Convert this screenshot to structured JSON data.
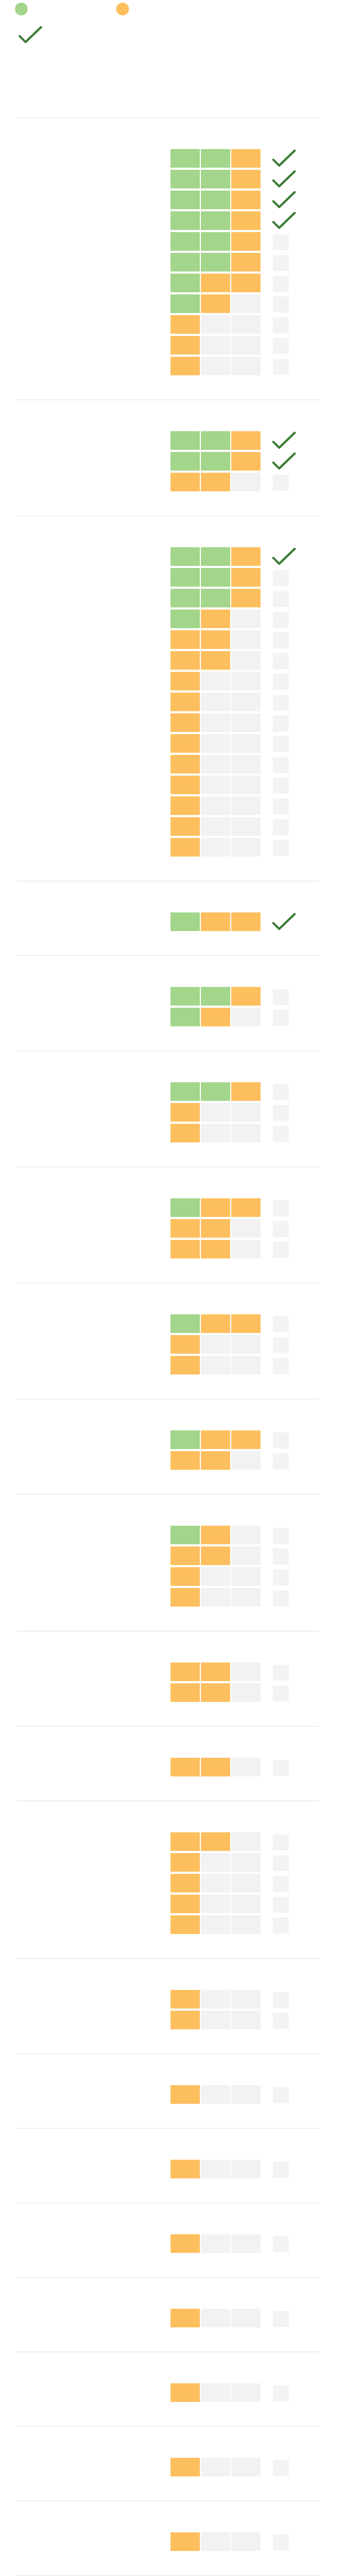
{
  "colors": {
    "green": "#a3d58a",
    "orange": "#fdbf5e",
    "empty": "#f2f2f2",
    "check": "#3a7a33",
    "divider": "#efefef"
  },
  "legend": [
    {
      "color": "green"
    },
    {
      "color": "orange"
    }
  ],
  "header": {
    "icon": "check-icon"
  },
  "groups": [
    {
      "rows": [
        {
          "cells": [
            "g",
            "g",
            "o"
          ],
          "checked": true
        },
        {
          "cells": [
            "g",
            "g",
            "o"
          ],
          "checked": true
        },
        {
          "cells": [
            "g",
            "g",
            "o"
          ],
          "checked": true
        },
        {
          "cells": [
            "g",
            "g",
            "o"
          ],
          "checked": true
        },
        {
          "cells": [
            "g",
            "g",
            "o"
          ],
          "checked": false
        },
        {
          "cells": [
            "g",
            "g",
            "o"
          ],
          "checked": false
        },
        {
          "cells": [
            "g",
            "o",
            "o"
          ],
          "checked": false
        },
        {
          "cells": [
            "g",
            "o",
            "e"
          ],
          "checked": false
        },
        {
          "cells": [
            "o",
            "e",
            "e"
          ],
          "checked": false
        },
        {
          "cells": [
            "o",
            "e",
            "e"
          ],
          "checked": false
        },
        {
          "cells": [
            "o",
            "e",
            "e"
          ],
          "checked": false
        }
      ]
    },
    {
      "rows": [
        {
          "cells": [
            "g",
            "g",
            "o"
          ],
          "checked": true
        },
        {
          "cells": [
            "g",
            "g",
            "o"
          ],
          "checked": true
        },
        {
          "cells": [
            "o",
            "o",
            "e"
          ],
          "checked": false
        }
      ]
    },
    {
      "rows": [
        {
          "cells": [
            "g",
            "g",
            "o"
          ],
          "checked": true
        },
        {
          "cells": [
            "g",
            "g",
            "o"
          ],
          "checked": false
        },
        {
          "cells": [
            "g",
            "g",
            "o"
          ],
          "checked": false
        },
        {
          "cells": [
            "g",
            "o",
            "e"
          ],
          "checked": false
        },
        {
          "cells": [
            "o",
            "o",
            "e"
          ],
          "checked": false
        },
        {
          "cells": [
            "o",
            "o",
            "e"
          ],
          "checked": false
        },
        {
          "cells": [
            "o",
            "e",
            "e"
          ],
          "checked": false
        },
        {
          "cells": [
            "o",
            "e",
            "e"
          ],
          "checked": false
        },
        {
          "cells": [
            "o",
            "e",
            "e"
          ],
          "checked": false
        },
        {
          "cells": [
            "o",
            "e",
            "e"
          ],
          "checked": false
        },
        {
          "cells": [
            "o",
            "e",
            "e"
          ],
          "checked": false
        },
        {
          "cells": [
            "o",
            "e",
            "e"
          ],
          "checked": false
        },
        {
          "cells": [
            "o",
            "e",
            "e"
          ],
          "checked": false
        },
        {
          "cells": [
            "o",
            "e",
            "e"
          ],
          "checked": false
        },
        {
          "cells": [
            "o",
            "e",
            "e"
          ],
          "checked": false
        }
      ]
    },
    {
      "rows": [
        {
          "cells": [
            "g",
            "o",
            "o"
          ],
          "checked": true
        }
      ]
    },
    {
      "rows": [
        {
          "cells": [
            "g",
            "g",
            "o"
          ],
          "checked": false
        },
        {
          "cells": [
            "g",
            "o",
            "e"
          ],
          "checked": false
        }
      ]
    },
    {
      "rows": [
        {
          "cells": [
            "g",
            "g",
            "o"
          ],
          "checked": false
        },
        {
          "cells": [
            "o",
            "e",
            "e"
          ],
          "checked": false
        },
        {
          "cells": [
            "o",
            "e",
            "e"
          ],
          "checked": false
        }
      ]
    },
    {
      "rows": [
        {
          "cells": [
            "g",
            "o",
            "o"
          ],
          "checked": false
        },
        {
          "cells": [
            "o",
            "o",
            "e"
          ],
          "checked": false
        },
        {
          "cells": [
            "o",
            "o",
            "e"
          ],
          "checked": false
        }
      ]
    },
    {
      "rows": [
        {
          "cells": [
            "g",
            "o",
            "o"
          ],
          "checked": false
        },
        {
          "cells": [
            "o",
            "e",
            "e"
          ],
          "checked": false
        },
        {
          "cells": [
            "o",
            "e",
            "e"
          ],
          "checked": false
        }
      ]
    },
    {
      "rows": [
        {
          "cells": [
            "g",
            "o",
            "o"
          ],
          "checked": false
        },
        {
          "cells": [
            "o",
            "o",
            "e"
          ],
          "checked": false
        }
      ]
    },
    {
      "rows": [
        {
          "cells": [
            "g",
            "o",
            "e"
          ],
          "checked": false
        },
        {
          "cells": [
            "o",
            "o",
            "e"
          ],
          "checked": false
        },
        {
          "cells": [
            "o",
            "e",
            "e"
          ],
          "checked": false
        },
        {
          "cells": [
            "o",
            "e",
            "e"
          ],
          "checked": false
        }
      ]
    },
    {
      "rows": [
        {
          "cells": [
            "o",
            "o",
            "e"
          ],
          "checked": false
        },
        {
          "cells": [
            "o",
            "o",
            "e"
          ],
          "checked": false
        }
      ]
    },
    {
      "rows": [
        {
          "cells": [
            "o",
            "o",
            "e"
          ],
          "checked": false
        }
      ]
    },
    {
      "rows": [
        {
          "cells": [
            "o",
            "o",
            "e"
          ],
          "checked": false
        },
        {
          "cells": [
            "o",
            "e",
            "e"
          ],
          "checked": false
        },
        {
          "cells": [
            "o",
            "e",
            "e"
          ],
          "checked": false
        },
        {
          "cells": [
            "o",
            "e",
            "e"
          ],
          "checked": false
        },
        {
          "cells": [
            "o",
            "e",
            "e"
          ],
          "checked": false
        }
      ]
    },
    {
      "rows": [
        {
          "cells": [
            "o",
            "e",
            "e"
          ],
          "checked": false
        },
        {
          "cells": [
            "o",
            "e",
            "e"
          ],
          "checked": false
        }
      ]
    },
    {
      "rows": [
        {
          "cells": [
            "o",
            "e",
            "e"
          ],
          "checked": false
        }
      ]
    },
    {
      "rows": [
        {
          "cells": [
            "o",
            "e",
            "e"
          ],
          "checked": false
        }
      ]
    },
    {
      "rows": [
        {
          "cells": [
            "o",
            "e",
            "e"
          ],
          "checked": false
        }
      ]
    },
    {
      "rows": [
        {
          "cells": [
            "o",
            "e",
            "e"
          ],
          "checked": false
        }
      ]
    },
    {
      "rows": [
        {
          "cells": [
            "o",
            "e",
            "e"
          ],
          "checked": false
        }
      ]
    },
    {
      "rows": [
        {
          "cells": [
            "o",
            "e",
            "e"
          ],
          "checked": false
        }
      ]
    },
    {
      "rows": [
        {
          "cells": [
            "o",
            "e",
            "e"
          ],
          "checked": false
        }
      ]
    }
  ]
}
